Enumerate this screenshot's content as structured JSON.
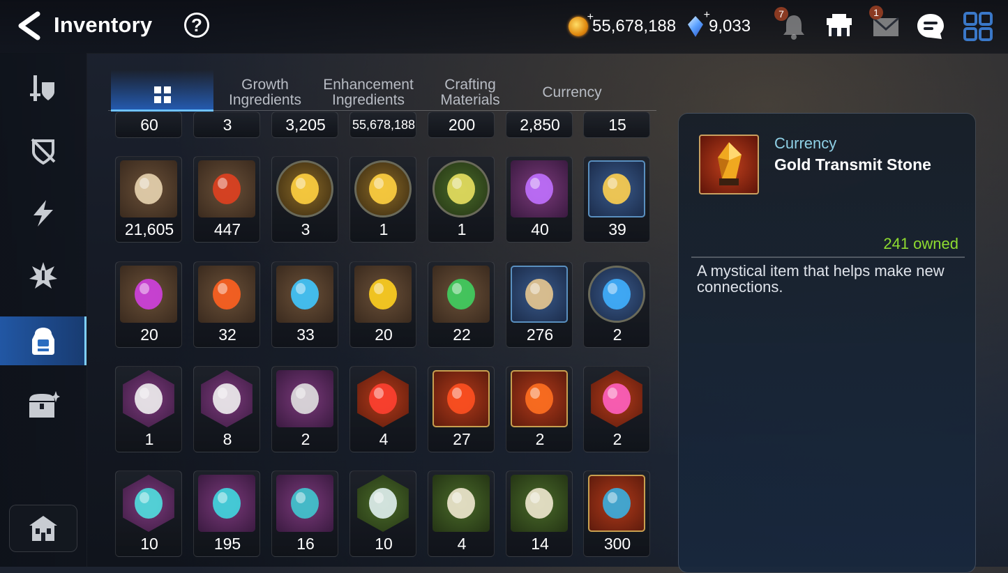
{
  "header": {
    "title": "Inventory",
    "help_icon": "question-icon",
    "gold": "55,678,188",
    "crystals": "9,033",
    "notifications_badge": "7",
    "mail_badge": "1"
  },
  "sidebar": {
    "items": [
      {
        "icon": "sword-shield-icon",
        "active": false
      },
      {
        "icon": "broken-shield-icon",
        "active": false
      },
      {
        "icon": "lightning-icon",
        "active": false
      },
      {
        "icon": "burst-icon",
        "active": false
      },
      {
        "icon": "backpack-icon",
        "active": true
      },
      {
        "icon": "treasure-chest-icon",
        "active": false
      }
    ],
    "home_icon": "home-icon"
  },
  "tabs": [
    {
      "label": "",
      "icon": "grid-icon",
      "active": true
    },
    {
      "label": "Growth\nIngredients",
      "active": false
    },
    {
      "label": "Enhancement\nIngredients",
      "active": false
    },
    {
      "label": "Crafting\nMaterials",
      "active": false
    },
    {
      "label": "Currency",
      "active": false
    }
  ],
  "items": [
    {
      "count": "60"
    },
    {
      "count": "3"
    },
    {
      "count": "3,205"
    },
    {
      "count": "55,678,188"
    },
    {
      "count": "200"
    },
    {
      "count": "2,850"
    },
    {
      "count": "15"
    },
    {
      "count": "21,605",
      "icon": "horse-token-icon"
    },
    {
      "count": "447",
      "icon": "leaf-rune-icon"
    },
    {
      "count": "3",
      "icon": "yellow-creature-icon"
    },
    {
      "count": "1",
      "icon": "yellow-creature-icon"
    },
    {
      "count": "1",
      "icon": "green-creature-icon"
    },
    {
      "count": "40",
      "icon": "purple-flower-icon"
    },
    {
      "count": "39",
      "icon": "gold-flower-icon"
    },
    {
      "count": "20",
      "icon": "purple-gem-icon"
    },
    {
      "count": "32",
      "icon": "orange-gem-icon"
    },
    {
      "count": "33",
      "icon": "blue-gem-icon"
    },
    {
      "count": "20",
      "icon": "yellow-gem-icon"
    },
    {
      "count": "22",
      "icon": "green-gem-icon"
    },
    {
      "count": "276",
      "icon": "ginseng-root-icon"
    },
    {
      "count": "2",
      "icon": "blue-sigil-icon"
    },
    {
      "count": "1",
      "icon": "pet-pack-icon"
    },
    {
      "count": "8",
      "icon": "pet-pack-icon"
    },
    {
      "count": "2",
      "icon": "feather-wand-icon"
    },
    {
      "count": "4",
      "icon": "red-star-shard-icon"
    },
    {
      "count": "27",
      "icon": "red-t-stone-icon"
    },
    {
      "count": "2",
      "icon": "red-bolt-stone-icon"
    },
    {
      "count": "2",
      "icon": "pink-potion-icon"
    },
    {
      "count": "10",
      "icon": "teal-star-shard-icon"
    },
    {
      "count": "195",
      "icon": "teal-t-stone-icon"
    },
    {
      "count": "16",
      "icon": "teal-bolt-stone-icon"
    },
    {
      "count": "10",
      "icon": "white-star-shard-icon"
    },
    {
      "count": "4",
      "icon": "white-t-stone-icon"
    },
    {
      "count": "14",
      "icon": "white-bolt-stone-icon"
    },
    {
      "count": "300",
      "icon": "blue-feather-icon"
    }
  ],
  "detail": {
    "category": "Currency",
    "name": "Gold Transmit Stone",
    "owned": "241 owned",
    "description": "A mystical item that helps make new connections.",
    "icon": "gold-transmit-stone-icon"
  }
}
